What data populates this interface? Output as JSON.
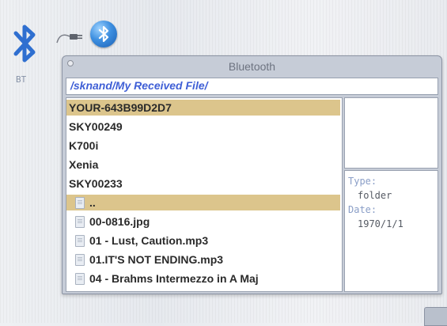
{
  "desktop": {
    "bt_label": "BT",
    "icons": [
      "bluetooth-icon",
      "plug-icon",
      "bluetooth-round-icon"
    ]
  },
  "window": {
    "title": "Bluetooth",
    "path": "/sknand/My Received File/",
    "rows": [
      {
        "label": "YOUR-643B99D2D7",
        "type": "device",
        "selected": true
      },
      {
        "label": "SKY00249",
        "type": "device",
        "selected": false
      },
      {
        "label": "K700i",
        "type": "device",
        "selected": false
      },
      {
        "label": "Xenia",
        "type": "device",
        "selected": false
      },
      {
        "label": "SKY00233",
        "type": "device",
        "selected": false
      },
      {
        "label": "..",
        "type": "file",
        "selected": true
      },
      {
        "label": "00-0816.jpg",
        "type": "file",
        "selected": false
      },
      {
        "label": "01 - Lust, Caution.mp3",
        "type": "file",
        "selected": false
      },
      {
        "label": "01.IT'S NOT ENDING.mp3",
        "type": "file",
        "selected": false
      },
      {
        "label": "04 - Brahms Intermezzo in A Maj",
        "type": "file",
        "selected": false
      }
    ],
    "info": {
      "type_label": "Type:",
      "type_value": "folder",
      "date_label": "Date:",
      "date_value": "1970/1/1"
    }
  },
  "colors": {
    "selection": "#dcc58c",
    "path_text": "#3f5fd6",
    "bluetooth_blue": "#2f6fd0"
  }
}
